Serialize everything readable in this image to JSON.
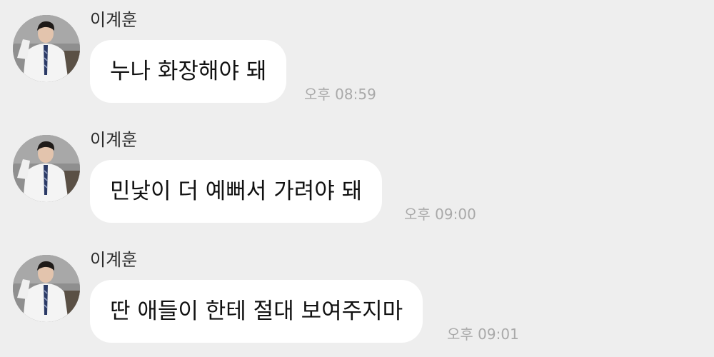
{
  "messages": [
    {
      "sender": "이계훈",
      "text": "누나 화장해야 돼",
      "time": "오후 08:59",
      "avatar_icon": "profile-photo-icon"
    },
    {
      "sender": "이계훈",
      "text": "민낯이 더 예뻐서 가려야 돼",
      "time": "오후 09:00",
      "avatar_icon": "profile-photo-icon"
    },
    {
      "sender": "이계훈",
      "text": "딴 애들이 한테 절대 보여주지마",
      "time": "오후 09:01",
      "avatar_icon": "profile-photo-icon"
    }
  ],
  "colors": {
    "background": "#eeeeee",
    "bubble": "#ffffff",
    "timestamp": "#a9a9a9"
  }
}
